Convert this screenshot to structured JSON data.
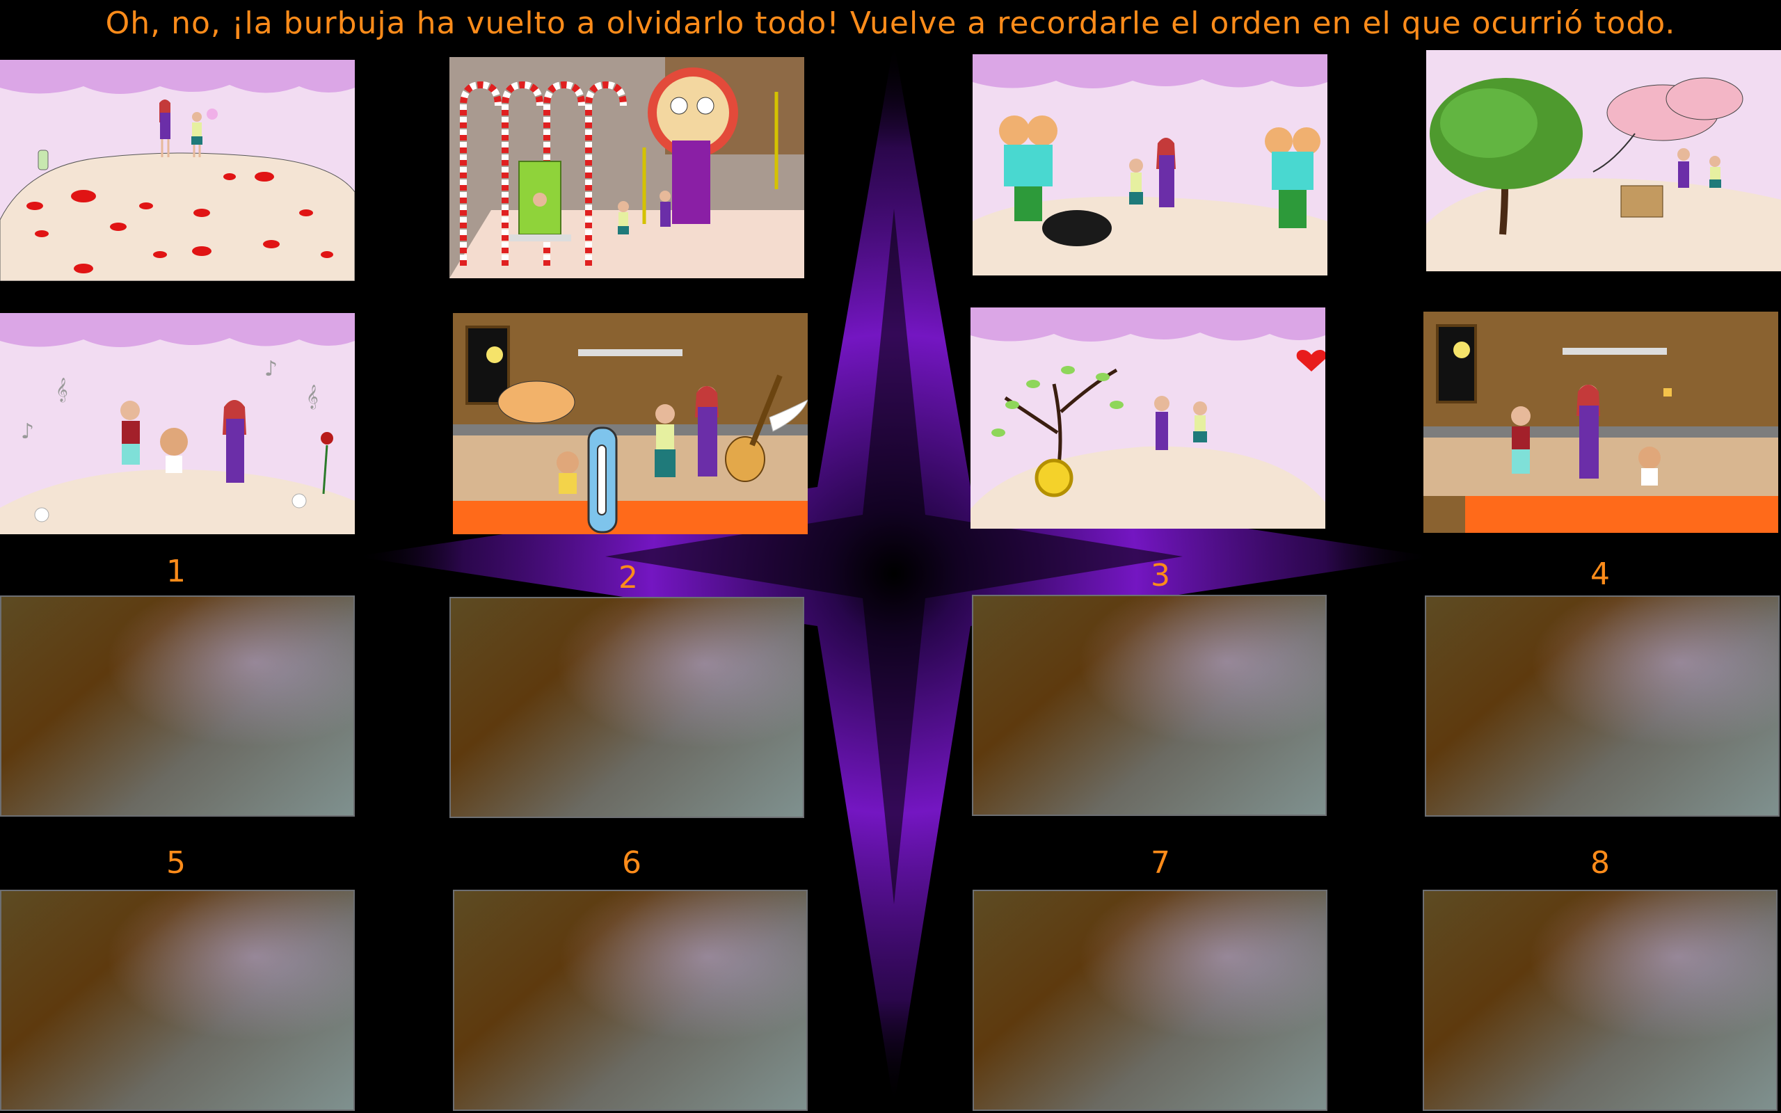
{
  "title": "Oh, no, ¡la burbuja ha vuelto a olvidarlo todo! Vuelve a recordarle el orden en el que ocurrió todo.",
  "slots": [
    {
      "number": "1"
    },
    {
      "number": "2"
    },
    {
      "number": "3"
    },
    {
      "number": "4"
    },
    {
      "number": "5"
    },
    {
      "number": "6"
    },
    {
      "number": "7"
    },
    {
      "number": "8"
    }
  ],
  "colors": {
    "accent": "#ff8c1a",
    "glow": "#7a17cc",
    "background": "#000000",
    "sky": "#f2dcf2",
    "drip": "#dba6e6",
    "ground": "#f4e4d4",
    "kitchen_wall": "#8a6230",
    "kitchen_floor": "#ff6a1a"
  }
}
